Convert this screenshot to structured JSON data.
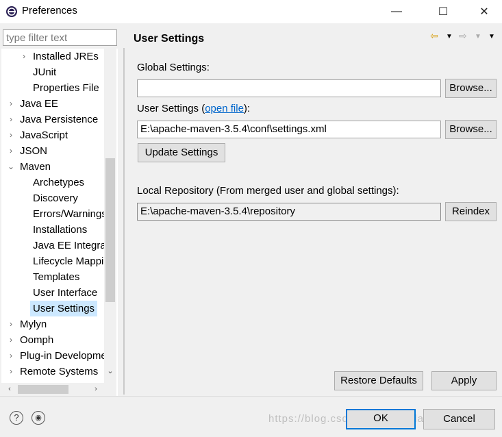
{
  "window": {
    "title": "Preferences"
  },
  "filter": {
    "placeholder": "type filter text"
  },
  "tree": {
    "items": [
      {
        "label": "Installed JREs",
        "level": 1,
        "expander": "›"
      },
      {
        "label": "JUnit",
        "level": 1
      },
      {
        "label": "Properties File",
        "level": 1
      },
      {
        "label": "Java EE",
        "level": 0,
        "expander": "›"
      },
      {
        "label": "Java Persistence",
        "level": 0,
        "expander": "›"
      },
      {
        "label": "JavaScript",
        "level": 0,
        "expander": "›"
      },
      {
        "label": "JSON",
        "level": 0,
        "expander": "›"
      },
      {
        "label": "Maven",
        "level": 0,
        "expander": "⌄"
      },
      {
        "label": "Archetypes",
        "level": 1
      },
      {
        "label": "Discovery",
        "level": 1
      },
      {
        "label": "Errors/Warnings",
        "level": 1
      },
      {
        "label": "Installations",
        "level": 1
      },
      {
        "label": "Java EE Integration",
        "level": 1
      },
      {
        "label": "Lifecycle Mappings",
        "level": 1
      },
      {
        "label": "Templates",
        "level": 1
      },
      {
        "label": "User Interface",
        "level": 1
      },
      {
        "label": "User Settings",
        "level": 1,
        "selected": true
      },
      {
        "label": "Mylyn",
        "level": 0,
        "expander": "›"
      },
      {
        "label": "Oomph",
        "level": 0,
        "expander": "›"
      },
      {
        "label": "Plug-in Development",
        "level": 0,
        "expander": "›"
      },
      {
        "label": "Remote Systems",
        "level": 0,
        "expander": "›"
      }
    ]
  },
  "panel": {
    "title": "User Settings",
    "global_settings_label": "Global Settings:",
    "global_settings_value": "",
    "browse_label": "Browse...",
    "user_settings_label_pre": "User Settings (",
    "open_file_link": "open file",
    "user_settings_label_post": "):",
    "user_settings_value": "E:\\apache-maven-3.5.4\\conf\\settings.xml",
    "update_settings_label": "Update Settings",
    "local_repo_label": "Local Repository (From merged user and global settings):",
    "local_repo_value": "E:\\apache-maven-3.5.4\\repository",
    "reindex_label": "Reindex",
    "restore_defaults_label": "Restore Defaults",
    "apply_label": "Apply"
  },
  "footer": {
    "ok_label": "OK",
    "cancel_label": "Cancel",
    "watermark": "https://blog.csdn.net/anyorrilauche"
  },
  "colors": {
    "selection": "#cce8ff",
    "link": "#0066cc",
    "default_button_border": "#0078d7"
  }
}
